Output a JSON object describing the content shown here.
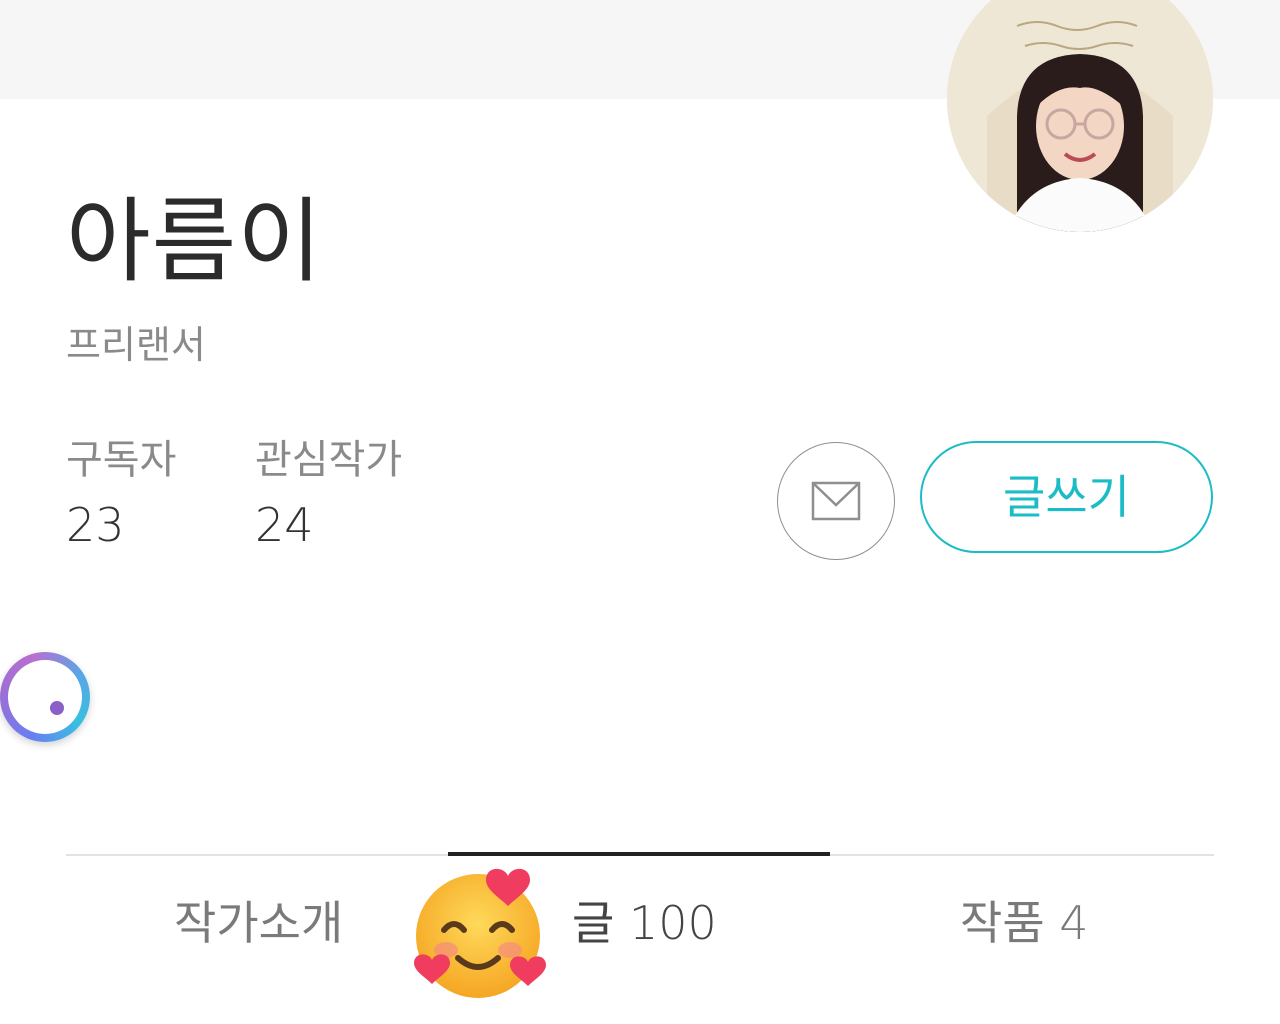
{
  "profile": {
    "name": "아름이",
    "job": "프리랜서"
  },
  "stats": {
    "subscribers_label": "구독자",
    "subscribers_value": "23",
    "following_label": "관심작가",
    "following_value": "24"
  },
  "actions": {
    "mail_icon": "envelope-icon",
    "write_label": "글쓰기"
  },
  "tabs": [
    {
      "label": "작가소개"
    },
    {
      "label": "글 100"
    },
    {
      "label": "작품 4"
    }
  ],
  "active_tab": "글 100",
  "colors": {
    "accent": "#1bbcc6",
    "top_band": "#f6f6f6",
    "text_dark": "#2b2b2b",
    "text_muted": "#8a8a8a"
  }
}
